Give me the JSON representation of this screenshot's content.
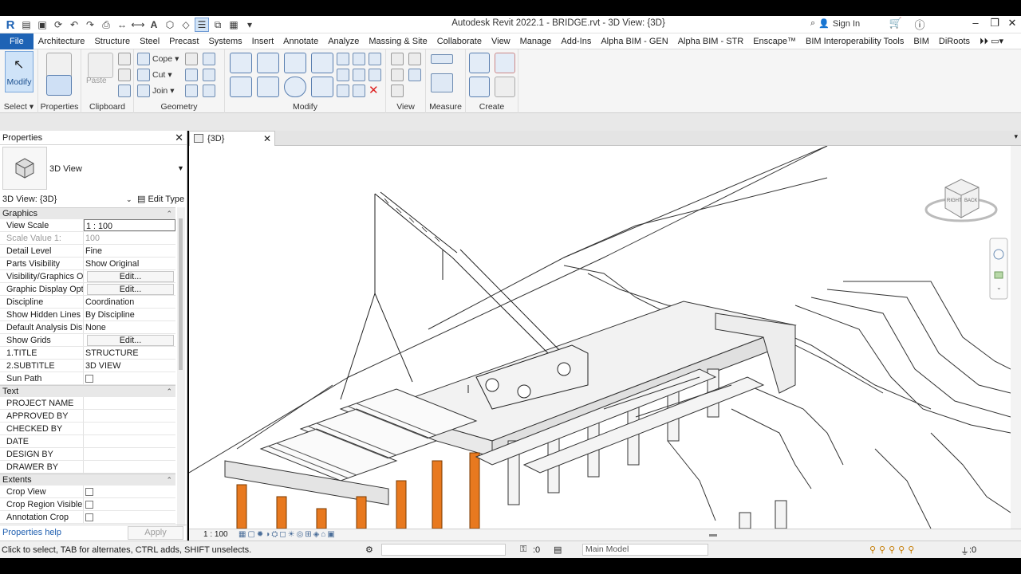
{
  "window": {
    "title": "Autodesk Revit 2022.1 - BRIDGE.rvt - 3D View: {3D}",
    "sign_in": "Sign In"
  },
  "menu": {
    "tabs": [
      "File",
      "Architecture",
      "Structure",
      "Steel",
      "Precast",
      "Systems",
      "Insert",
      "Annotate",
      "Analyze",
      "Massing & Site",
      "Collaborate",
      "View",
      "Manage",
      "Add-Ins",
      "Alpha BIM - GEN",
      "Alpha BIM - STR",
      "Enscape™",
      "BIM Interoperability Tools",
      "BIM",
      "DiRoots"
    ]
  },
  "ribbon": {
    "modify_label": "Modify",
    "paste_label": "Paste",
    "cope_label": "Cope",
    "cut_label": "Cut",
    "join_label": "Join",
    "panels": {
      "select": "Select",
      "properties": "Properties",
      "clipboard": "Clipboard",
      "geometry": "Geometry",
      "modify": "Modify",
      "view": "View",
      "measure": "Measure",
      "create": "Create"
    }
  },
  "properties": {
    "title": "Properties",
    "type_name": "3D View",
    "instance": "3D View: {3D}",
    "edit_type": "Edit Type",
    "sections": {
      "graphics": "Graphics",
      "text": "Text",
      "extents": "Extents"
    },
    "graphics_rows": [
      {
        "k": "View Scale",
        "v": "1 : 100"
      },
      {
        "k": "Scale Value    1:",
        "v": "100"
      },
      {
        "k": "Detail Level",
        "v": "Fine"
      },
      {
        "k": "Parts Visibility",
        "v": "Show Original"
      },
      {
        "k": "Visibility/Graphics O...",
        "v": "Edit..."
      },
      {
        "k": "Graphic Display Opt...",
        "v": "Edit..."
      },
      {
        "k": "Discipline",
        "v": "Coordination"
      },
      {
        "k": "Show Hidden Lines",
        "v": "By Discipline"
      },
      {
        "k": "Default Analysis Dis...",
        "v": "None"
      },
      {
        "k": "Show Grids",
        "v": "Edit..."
      },
      {
        "k": "1.TITLE",
        "v": "STRUCTURE"
      },
      {
        "k": "2.SUBTITLE",
        "v": "3D VIEW"
      },
      {
        "k": "Sun Path",
        "v": ""
      }
    ],
    "text_rows": [
      {
        "k": "PROJECT NAME",
        "v": ""
      },
      {
        "k": "APPROVED BY",
        "v": ""
      },
      {
        "k": "CHECKED BY",
        "v": ""
      },
      {
        "k": "DATE",
        "v": ""
      },
      {
        "k": "DESIGN BY",
        "v": ""
      },
      {
        "k": "DRAWER BY",
        "v": ""
      }
    ],
    "extents_rows": [
      {
        "k": "Crop View",
        "v": ""
      },
      {
        "k": "Crop Region Visible",
        "v": ""
      },
      {
        "k": "Annotation Crop",
        "v": ""
      }
    ],
    "help": "Properties help",
    "apply": "Apply"
  },
  "view": {
    "tab_label": "{3D}",
    "scale": "1 : 100",
    "viewcube": {
      "right": "RIGHT",
      "back": "BACK"
    }
  },
  "status": {
    "message": "Click to select, TAB for alternates, CTRL adds, SHIFT unselects.",
    "zero": ":0",
    "model": "Main Model",
    "filter": ":0"
  },
  "colors": {
    "accent": "#1e63b5",
    "pier": "#e8791f"
  }
}
